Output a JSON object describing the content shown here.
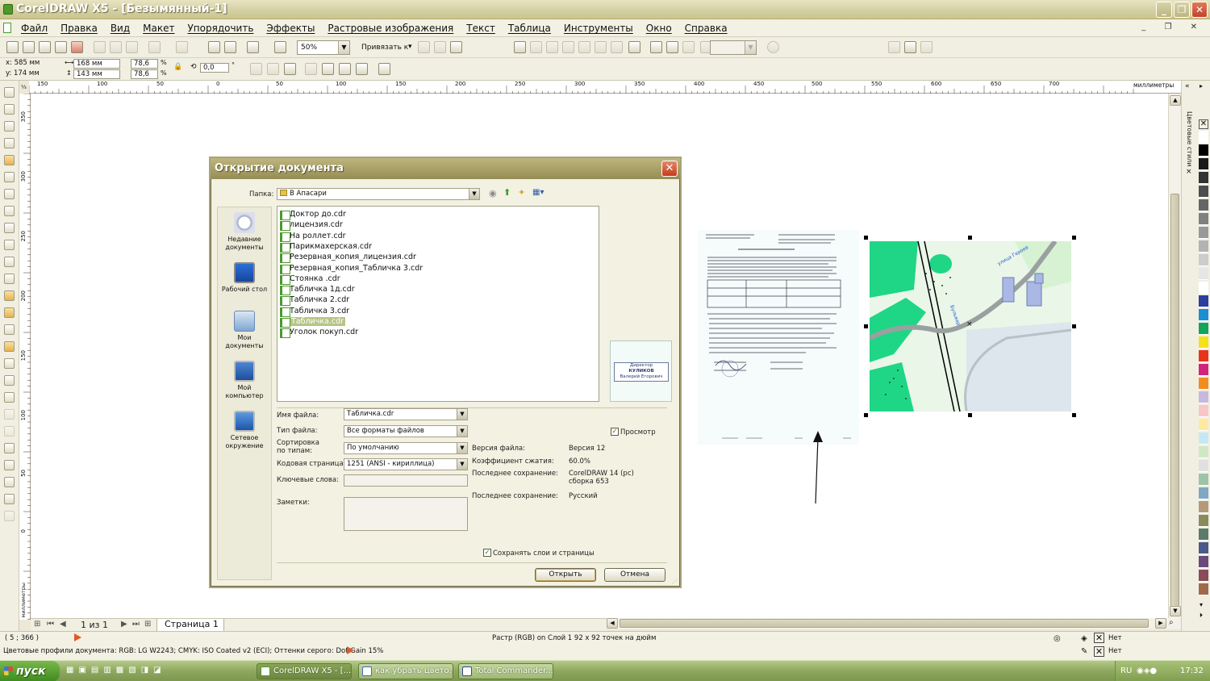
{
  "window": {
    "title": "CorelDRAW X5 - [Безымянный-1]"
  },
  "menu": [
    "Файл",
    "Правка",
    "Вид",
    "Макет",
    "Упорядочить",
    "Эффекты",
    "Растровые изображения",
    "Текст",
    "Таблица",
    "Инструменты",
    "Окно",
    "Справка"
  ],
  "toolbar": {
    "zoom": "50%",
    "snap_label": "Привязать к"
  },
  "props": {
    "x": "x: 585 мм",
    "y": "y: 174 мм",
    "w": "168 мм",
    "h": "143 мм",
    "sx": "78,6",
    "sy": "78,6",
    "pct": "%",
    "angle": "0,0"
  },
  "ruler": {
    "unit": "миллиметры",
    "h_ticks": [
      "150",
      "100",
      "50",
      "0",
      "50",
      "100",
      "150",
      "200",
      "250",
      "300",
      "350",
      "400",
      "450",
      "500",
      "550",
      "600",
      "650",
      "700"
    ],
    "v_ticks": [
      "350",
      "300",
      "250",
      "200",
      "150",
      "100",
      "50",
      "0"
    ],
    "v_unit": "миллиметры"
  },
  "dockers": {
    "color_styles": "Цветовые стили"
  },
  "palette_colors": [
    "#ffffff",
    "#000000",
    "#1a1a1a",
    "#333333",
    "#4d4d4d",
    "#666666",
    "#808080",
    "#999999",
    "#b3b3b3",
    "#cccccc",
    "#e6e6e6",
    "#ffffff",
    "#2a3f9e",
    "#1a8fd6",
    "#12a55a",
    "#f5e11a",
    "#e8341c",
    "#d4237c",
    "#f28c1e",
    "#c7b8e0",
    "#f9c6c6",
    "#fdeaa0",
    "#c6e8f4",
    "#cfe8c4",
    "#e0e0e0",
    "#9dc3a8",
    "#7fa8c4",
    "#b59a7a",
    "#8a8a5c",
    "#5c7a6a",
    "#4a5a8a",
    "#6a4a7a",
    "#8a4a5a",
    "#a06a4a"
  ],
  "pages": {
    "count_text": "1 из 1",
    "tab": "Страница 1"
  },
  "status": {
    "coords": "( 5    ; 366   )",
    "center": "Растр (RGB) on Слой 1 92 x 92 точек на дюйм",
    "profile": "Цветовые профили документа: RGB: LG W2243; CMYK: ISO Coated v2 (ECI); Оттенки серого: Dot Gain 15%",
    "fill_none": "Нет",
    "outline_none": "Нет"
  },
  "dialog": {
    "title": "Открытие документа",
    "folder_label": "Папка:",
    "folder": "В Апасари",
    "places": [
      "Недавние документы",
      "Рабочий стол",
      "Мои документы",
      "Мой компьютер",
      "Сетевое окружение"
    ],
    "files": [
      "Доктор до.cdr",
      "лицензия.cdr",
      "На роллет.cdr",
      "Парикмахерская.cdr",
      "Резервная_копия_лицензия.cdr",
      "Резервная_копия_Табличка 3.cdr",
      "Стоянка .cdr",
      "Табличка 1д.cdr",
      "Табличка 2.cdr",
      "Табличка 3.cdr",
      "Табличка.cdr",
      "Уголок покуп.cdr"
    ],
    "selected_index": 10,
    "filename_label": "Имя файла:",
    "filename": "Табличка.cdr",
    "filetype_label": "Тип файла:",
    "filetype": "Все форматы файлов",
    "sort_label": "Сортировка\nпо типам:",
    "sort": "По умолчанию",
    "codepage_label": "Кодовая страница:",
    "codepage": "1251  (ANSI - кириллица)",
    "keywords_label": "Ключевые слова:",
    "notes_label": "Заметки:",
    "preview_label": "Просмотр",
    "preview_card": [
      "Директор",
      "КУЛИКОВ",
      "Валерий Егорович"
    ],
    "info": [
      {
        "k": "Версия файла:",
        "v": "Версия 12"
      },
      {
        "k": "Коэффициент сжатия:",
        "v": "60.0%"
      },
      {
        "k": "Последнее сохранение:",
        "v": "CorelDRAW 14 (pc)\nсборка 653"
      },
      {
        "k": "Последнее сохранение:",
        "v": "Русский"
      }
    ],
    "keep_layers": "Сохранять слои и страницы",
    "open_btn": "Открыть",
    "cancel_btn": "Отмена"
  },
  "taskbar": {
    "start": "пуск",
    "tasks": [
      "CorelDRAW X5 - [...",
      "как убрать цвето...",
      "Total Commander..."
    ],
    "lang": "RU",
    "clock": "17:32"
  }
}
